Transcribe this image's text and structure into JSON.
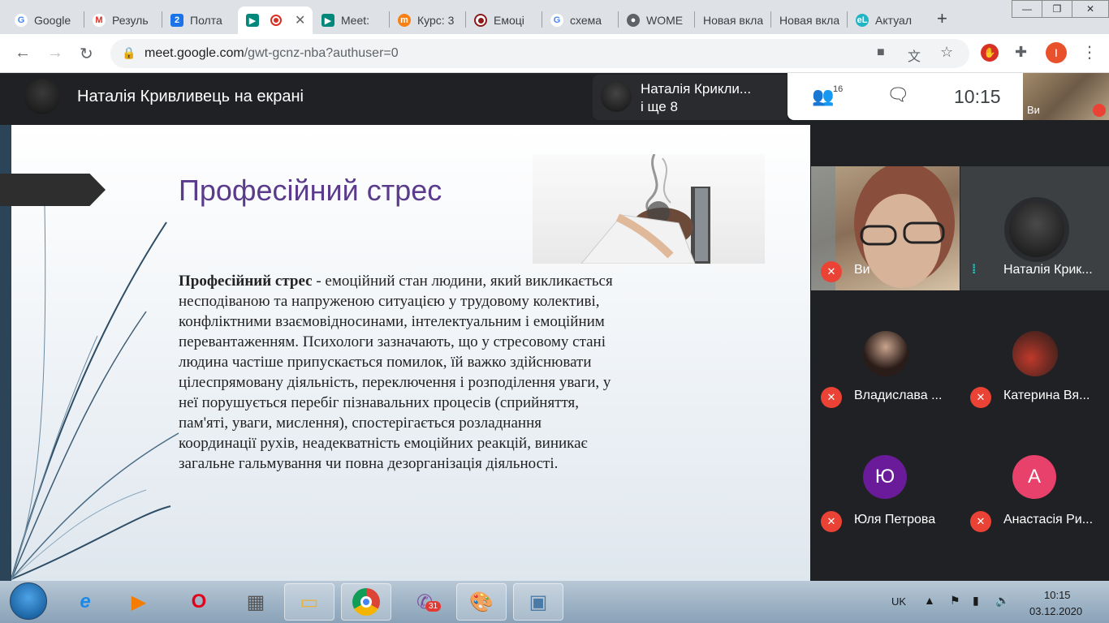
{
  "browser": {
    "tabs": [
      {
        "label": "Google",
        "icon": "google-icon"
      },
      {
        "label": "Резуль",
        "icon": "gmail-icon"
      },
      {
        "label": "Полта",
        "icon": "calendar-icon"
      },
      {
        "label": "",
        "icon": "meet-icon",
        "active": true
      },
      {
        "label": "Meet:",
        "icon": "meet-icon"
      },
      {
        "label": "Курс: 3",
        "icon": "moodle-icon"
      },
      {
        "label": "Емоці",
        "icon": "record-icon"
      },
      {
        "label": "схема",
        "icon": "google-icon"
      },
      {
        "label": "WOME",
        "icon": "globe-icon"
      },
      {
        "label": "Новая вкла",
        "icon": ""
      },
      {
        "label": "Новая вкла",
        "icon": ""
      },
      {
        "label": "Актуал",
        "icon": "el-icon"
      }
    ],
    "new_tab": "+",
    "url_host": "meet.google.com",
    "url_path": "/gwt-gcnz-nba?authuser=0",
    "profile_letter": "I"
  },
  "meet": {
    "presenter_title": "Наталія Кривливець на екрані",
    "present_card_name": "Наталія Крикли...",
    "present_card_more": "і ще 8",
    "people_count": "16",
    "time": "10:15",
    "self_label": "Ви"
  },
  "slide": {
    "title": "Професійний стрес",
    "body_bold": "Професійний стрес",
    "body_text": " - емоційний стан людини, який викликається несподіваною та напруженою ситуацією у трудовому колективі, конфліктними взаємовідносинами, інтелектуальним і емоційним перевантаженням. Психологи зазначають, що у стресовому стані людина частіше припускається помилок, їй важко здійснювати цілеспрямовану діяльність, переключення і розподілення уваги, у неї порушується перебіг пізнавальних процесів (сприйняття, пам'яті, уваги, мислення), спостерігається розладнання координації рухів, неадекватність емоційних реакцій, виникає загальне гальмування чи повна дезорганізація діяльності."
  },
  "participants": [
    {
      "name": "Ви",
      "avatar": "",
      "muted": true,
      "video": true
    },
    {
      "name": "Наталія Крик...",
      "avatar": "",
      "muted": false,
      "video": false
    },
    {
      "name": "Владислава ...",
      "avatar": "",
      "muted": true,
      "video": false
    },
    {
      "name": "Катерина Вя...",
      "avatar": "",
      "muted": true,
      "video": false
    },
    {
      "name": "Юля Петрова",
      "avatar": "Ю",
      "avatar_color": "#6a1b9a",
      "muted": true,
      "video": false
    },
    {
      "name": "Анастасія Ри...",
      "avatar": "А",
      "avatar_color": "#e8416b",
      "muted": true,
      "video": false
    }
  ],
  "taskbar": {
    "lang": "UK",
    "clock_time": "10:15",
    "clock_date": "03.12.2020",
    "viber_badge": "31"
  },
  "colors": {
    "meet_bg": "#202124",
    "mute_red": "#ea4335",
    "slide_title": "#5b3b8c"
  }
}
